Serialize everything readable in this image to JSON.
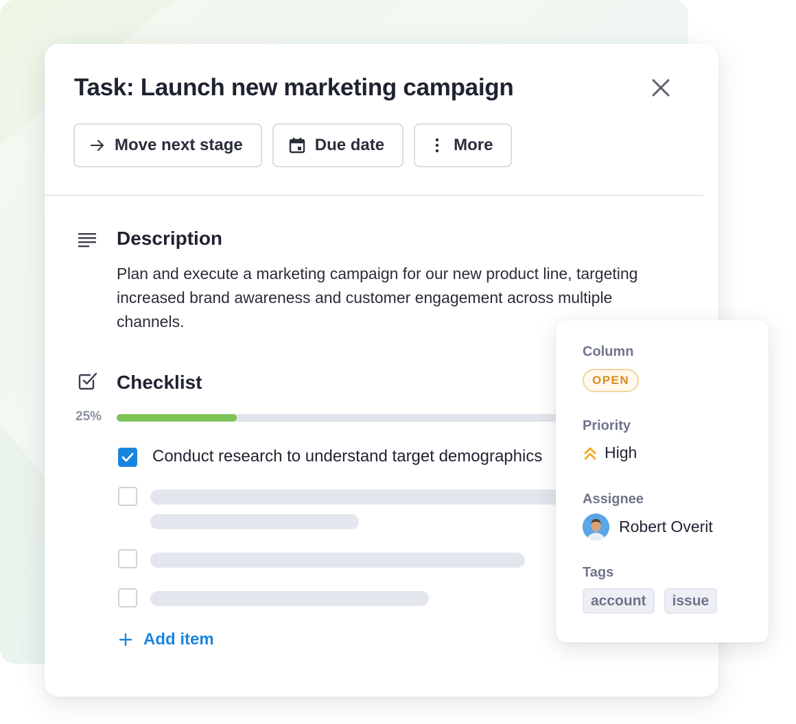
{
  "task": {
    "title": "Task: Launch new marketing campaign"
  },
  "actions": {
    "move_next_stage": "Move next stage",
    "due_date": "Due date",
    "more": "More"
  },
  "description": {
    "heading": "Description",
    "text": "Plan and execute a marketing campaign for our new product line, targeting increased brand awareness and customer engagement across multiple channels."
  },
  "checklist": {
    "heading": "Checklist",
    "progress_label": "25%",
    "progress_value": 0.25,
    "items": [
      {
        "text": "Conduct research to understand target demographics",
        "checked": true
      }
    ],
    "add_item_label": "Add item"
  },
  "details": {
    "column_label": "Column",
    "column_value": "OPEN",
    "priority_label": "Priority",
    "priority_value": "High",
    "assignee_label": "Assignee",
    "assignee_name": "Robert Overit",
    "tags_label": "Tags",
    "tags": [
      "account",
      "issue"
    ]
  },
  "colors": {
    "accent": "#1a85e0",
    "progress": "#7fc35b",
    "open_badge": "#d98a1f",
    "priority_high": "#f5a623"
  },
  "icons": {
    "close": "close-icon",
    "move": "arrow-right-icon",
    "due": "calendar-icon",
    "more": "more-vertical-icon",
    "description": "text-lines-icon",
    "checklist": "checkbox-icon",
    "priority": "double-chevron-up-icon",
    "add": "plus-icon"
  }
}
